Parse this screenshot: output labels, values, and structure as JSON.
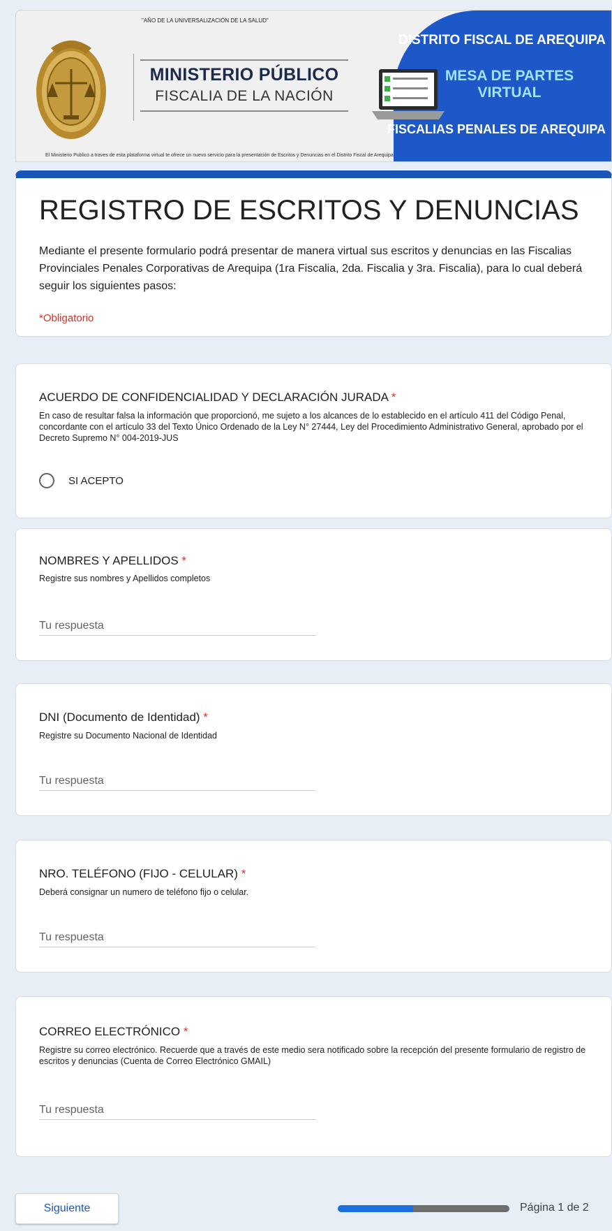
{
  "banner": {
    "top_quote": "\"AÑO DE LA UNIVERSALIZACIÓN DE LA SALUD\"",
    "brand_line1": "MINISTERIO PÚBLICO",
    "brand_line2": "FISCALIA DE LA NACIÓN",
    "district": "DISTRITO FISCAL DE AREQUIPA",
    "mesa_line1": "MESA DE PARTES",
    "mesa_line2": "VIRTUAL",
    "fiscalias": "FISCALIAS PENALES DE AREQUIPA",
    "bottom_note": "El Ministerio Publico a traves de esta plataforma virtual te ofrece un nuevo servicio para la presentación de Escritos y Denuncias en el Distrito Fiscal de Arequipa.",
    "colors": {
      "panel": "#1d58c9",
      "mesa_text": "#9fe3ff"
    }
  },
  "form": {
    "title": "REGISTRO DE ESCRITOS Y DENUNCIAS",
    "description": "Mediante el presente formulario podrá presentar de manera virtual sus escritos y denuncias en las Fiscalias Provinciales Penales Corporativas de Arequipa (1ra Fiscalia, 2da. Fiscalia y 3ra. Fiscalia), para lo cual deberá seguir los siguientes pasos:",
    "required_note": "*Obligatorio",
    "accent_color": "#1a56b8"
  },
  "questions": [
    {
      "title": "ACUERDO DE CONFIDENCIALIDAD Y DECLARACIÓN JURADA",
      "required_mark": "*",
      "help": "En caso de resultar falsa la información que proporcionó, me sujeto a los alcances de lo establecido en el artículo 411 del Código Penal, concordante con el artículo 33 del Texto Único Ordenado de la Ley N° 27444, Ley del Procedimiento Administrativo General, aprobado por el Decreto Supremo N° 004-2019-JUS",
      "option": "SI ACEPTO"
    },
    {
      "title": "NOMBRES Y APELLIDOS",
      "required_mark": "*",
      "help": "Registre sus nombres y Apellidos completos",
      "placeholder": "Tu respuesta"
    },
    {
      "title": "DNI (Documento de Identidad)",
      "required_mark": "*",
      "help": "Registre su Documento Nacional de Identidad",
      "placeholder": "Tu respuesta"
    },
    {
      "title": "NRO. TELÉFONO (FIJO - CELULAR)",
      "required_mark": "*",
      "help": "Deberá consignar un numero de teléfono fijo o celular.",
      "placeholder": "Tu respuesta"
    },
    {
      "title": "CORREO ELECTRÓNICO",
      "required_mark": "*",
      "help": "Registre su correo electrónico. Recuerde que a través de este medio sera notificado sobre la recepción del presente formulario de registro de escritos y denuncias (Cuenta de Correo Electrónico GMAIL)",
      "placeholder": "Tu respuesta"
    }
  ],
  "footer": {
    "next_label": "Siguiente",
    "page_label": "Página 1 de 2",
    "progress": 0.44
  }
}
